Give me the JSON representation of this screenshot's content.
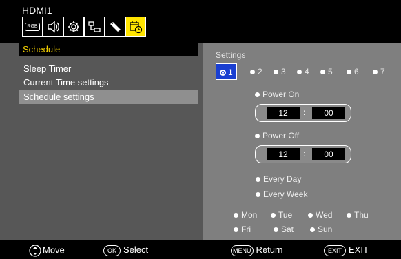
{
  "header": {
    "input_name": "HDMI1",
    "tools": [
      {
        "icon": "rgb-icon",
        "label": "RGB"
      },
      {
        "icon": "speaker-icon"
      },
      {
        "icon": "gear-icon"
      },
      {
        "icon": "network-icon"
      },
      {
        "icon": "remote-icon"
      },
      {
        "icon": "calendar-clock-icon",
        "active": true
      }
    ]
  },
  "left": {
    "section_title": "Schedule",
    "items": [
      {
        "label": "Sleep Timer"
      },
      {
        "label": "Current Time settings"
      },
      {
        "label": "Schedule settings",
        "selected": true
      }
    ]
  },
  "right": {
    "settings_label": "Settings",
    "programs": [
      "1",
      "2",
      "3",
      "4",
      "5",
      "6",
      "7"
    ],
    "selected_program": "1",
    "power_on": {
      "label": "Power On",
      "hour": "12",
      "minute": "00"
    },
    "power_off": {
      "label": "Power Off",
      "hour": "12",
      "minute": "00"
    },
    "repeat": [
      "Every Day",
      "Every Week"
    ],
    "days_row1": [
      "Mon",
      "Tue",
      "Wed",
      "Thu"
    ],
    "days_row2": [
      "Fri",
      "Sat",
      "Sun"
    ]
  },
  "footer": {
    "move": "Move",
    "ok_key": "OK",
    "select": "Select",
    "menu_key": "MENU",
    "return": "Return",
    "exit_key": "EXIT",
    "exit": "EXIT"
  },
  "colors": {
    "highlight": "#ffe400",
    "section_title": "#f4d000",
    "selected_program": "#1a3fd1"
  }
}
